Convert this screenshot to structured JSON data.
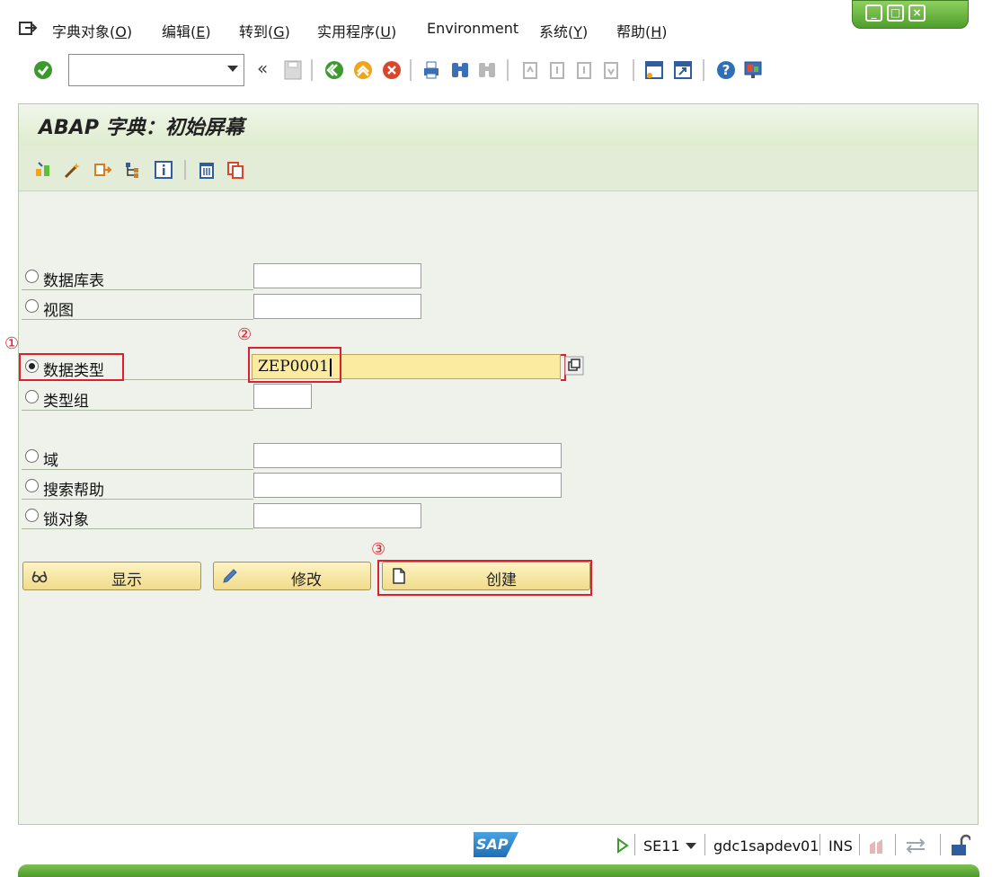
{
  "menubar": {
    "items": [
      {
        "label": "字典对象(",
        "key": "O",
        "tail": ")"
      },
      {
        "label": "编辑(",
        "key": "E",
        "tail": ")"
      },
      {
        "label": "转到(",
        "key": "G",
        "tail": ")"
      },
      {
        "label": "实用程序(",
        "key": "U",
        "tail": ")"
      },
      {
        "label": "Environment",
        "key": "",
        "tail": ""
      },
      {
        "label": "系统(",
        "key": "Y",
        "tail": ")"
      },
      {
        "label": "帮助(",
        "key": "H",
        "tail": ")"
      }
    ]
  },
  "toolbar": {
    "command_field_value": "",
    "collapse_label": "«"
  },
  "page": {
    "title": "ABAP 字典：初始屏幕"
  },
  "form": {
    "rows": [
      {
        "label": "数据库表",
        "value": "",
        "checked": false
      },
      {
        "label": "视图",
        "value": "",
        "checked": false
      },
      {
        "label": "数据类型",
        "value": "ZEP0001",
        "checked": true
      },
      {
        "label": "类型组",
        "value": "",
        "checked": false
      },
      {
        "label": "域",
        "value": "",
        "checked": false
      },
      {
        "label": "搜索帮助",
        "value": "",
        "checked": false
      },
      {
        "label": "锁对象",
        "value": "",
        "checked": false
      }
    ]
  },
  "buttons": {
    "display": "显示",
    "change": "修改",
    "create": "创建"
  },
  "annotations": {
    "step1": "①",
    "step2": "②",
    "step3": "③"
  },
  "statusbar": {
    "logo": "SAP",
    "transaction": "SE11",
    "server": "gdc1sapdev01",
    "mode": "INS"
  },
  "colors": {
    "accent_green": "#4f9e2b",
    "active_field": "#fbeba1",
    "annotation_red": "#e11f2c",
    "button_fill": "#f1dc8c"
  }
}
